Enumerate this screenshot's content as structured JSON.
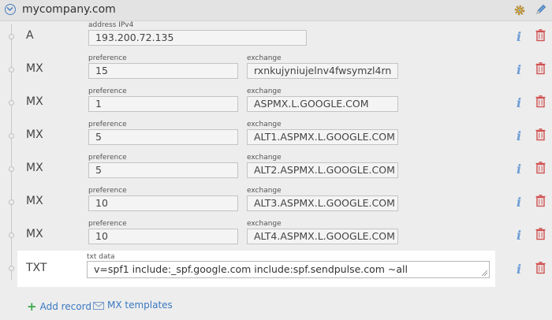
{
  "header": {
    "domain": "mycompany.com",
    "collapse_icon": "chevron-down-icon",
    "settings_icon": "gear-icon",
    "edit_icon": "pencil-icon"
  },
  "labels": {
    "address": "address IPv4",
    "preference": "preference",
    "exchange": "exchange",
    "txt_data": "txt data"
  },
  "records": [
    {
      "type": "A",
      "address": "193.200.72.135"
    },
    {
      "type": "MX",
      "preference": "15",
      "exchange": "rxnkujyniujelnv4fwsymzl4rn"
    },
    {
      "type": "MX",
      "preference": "1",
      "exchange": "ASPMX.L.GOOGLE.COM"
    },
    {
      "type": "MX",
      "preference": "5",
      "exchange": "ALT1.ASPMX.L.GOOGLE.COM"
    },
    {
      "type": "MX",
      "preference": "5",
      "exchange": "ALT2.ASPMX.L.GOOGLE.COM"
    },
    {
      "type": "MX",
      "preference": "10",
      "exchange": "ALT3.ASPMX.L.GOOGLE.COM"
    },
    {
      "type": "MX",
      "preference": "10",
      "exchange": "ALT4.ASPMX.L.GOOGLE.COM"
    },
    {
      "type": "TXT",
      "txt": "v=spf1 include:_spf.google.com include:spf.sendpulse.com ~all"
    }
  ],
  "row_icons": {
    "info": "i",
    "delete_icon": "trash-icon"
  },
  "footer": {
    "add_record": "Add record",
    "mx_templates": "MX templates"
  },
  "colors": {
    "link": "#3a78c2",
    "info": "#6e9ed6",
    "delete": "#d05050",
    "add": "#3aa84a"
  }
}
